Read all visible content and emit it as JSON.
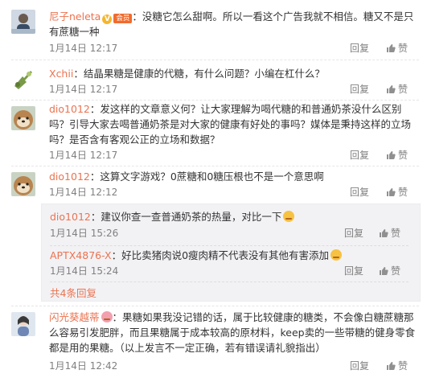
{
  "comments": [
    {
      "nick": "尼子neleta",
      "vip_badge": "V",
      "member_badge": "会员",
      "text": "：没糖它怎么甜啊。所以一看这个广告我就不相信。糖又不是只有蔗糖一种",
      "time": "1月14日 12:17",
      "reply_label": "回复",
      "like_label": "赞"
    },
    {
      "nick": "Xchii",
      "text": "：结晶果糖是健康的代糖，有什么问题？小编在杠什么？",
      "time": "1月14日 12:17",
      "reply_label": "回复",
      "like_label": "赞"
    },
    {
      "nick": "dio1012",
      "text": "：发这样的文章意义何？让大家理解为喝代糖的和普通奶茶没什么区别吗？引导大家去喝普通奶茶是对大家的健康有好处的事吗？媒体是秉持这样的立场吗？是否含有客观公正的立场和数据？",
      "time": "1月14日 12:17",
      "reply_label": "回复",
      "like_label": "赞"
    },
    {
      "nick": "dio1012",
      "text": "：这算文字游戏？0蔗糖和0糖压根也不是一个意思啊",
      "time": "1月14日 12:12",
      "reply_label": "回复",
      "like_label": "赞"
    },
    {
      "nick": "闪光葵越蒂",
      "text": "：果糖如果我没记错的话，属于比较健康的糖类，不会像白糖蔗糖那么容易引发肥胖，而且果糖属于成本较高的原材料，keep卖的一些带糖的健身零食都是用的果糖。（以上发言不一定正确，若有错误请礼貌指出）",
      "time": "1月14日 12:42",
      "reply_label": "回复",
      "like_label": "赞"
    }
  ],
  "sub_replies": [
    {
      "nick": "dio1012",
      "text": "：建议你查一查普通奶茶的热量，对比一下",
      "time": "1月14日 15:26",
      "reply_label": "回复",
      "like_label": "赞"
    },
    {
      "nick": "APTX4876-X",
      "text": "：好比卖猪肉说0瘦肉精不代表没有其他有害添加",
      "time": "1月14日 15:24",
      "reply_label": "回复",
      "like_label": "赞"
    }
  ],
  "more_replies": "共4条回复",
  "colors": {
    "nick": "#eb7350",
    "meta": "#808080",
    "sub_bg": "#f2f2f5"
  }
}
